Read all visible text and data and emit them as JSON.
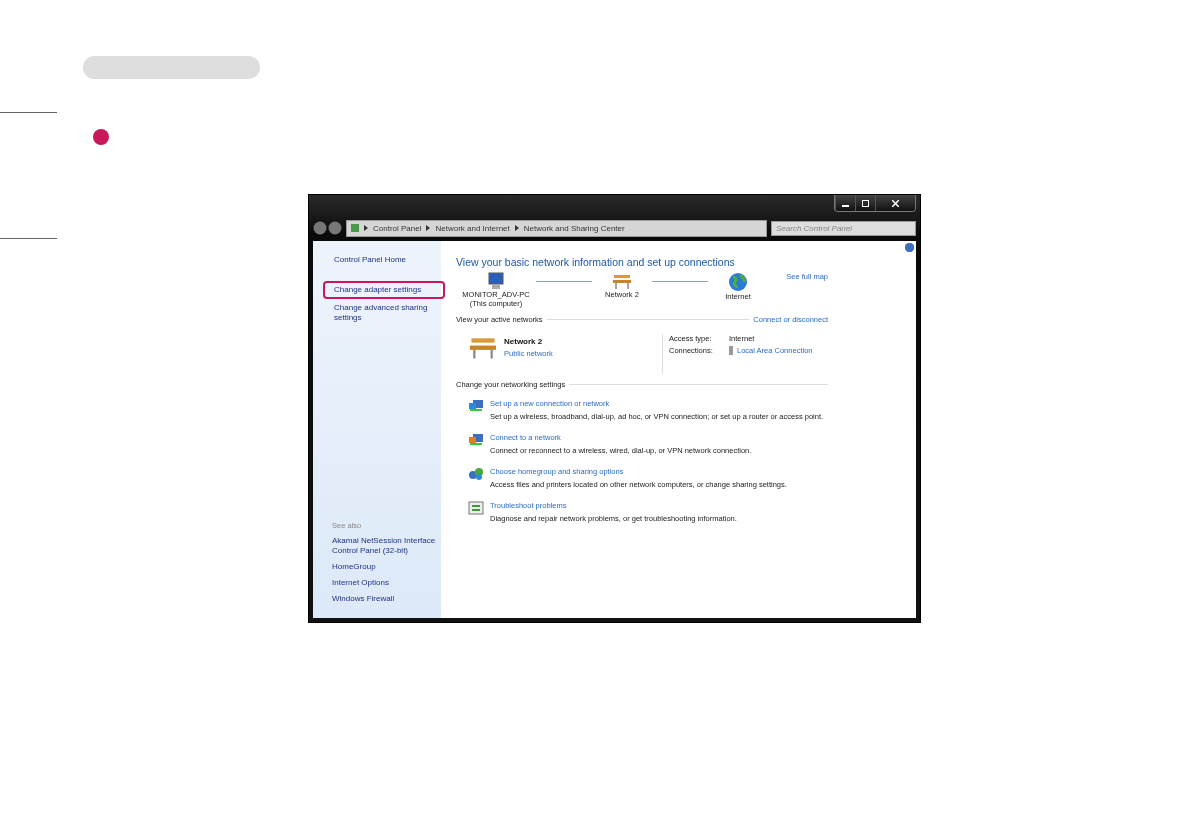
{
  "step_marker": {
    "color": "#c8185a"
  },
  "window": {
    "buttons": [
      {
        "kind": "minimize"
      },
      {
        "kind": "maximize"
      },
      {
        "kind": "close"
      }
    ],
    "breadcrumb": [
      "Control Panel",
      "Network and Internet",
      "Network and Sharing Center"
    ],
    "search": {
      "placeholder": "Search Control Panel"
    },
    "sidebar": {
      "items": [
        {
          "label": "Control Panel Home",
          "highlighted": false
        },
        {
          "label": "Change adapter settings",
          "highlighted": true
        },
        {
          "label": "Change advanced sharing settings",
          "highlighted": false
        }
      ],
      "see_also_title": "See also",
      "see_also": [
        "Akamai NetSession Interface Control Panel (32-bit)",
        "HomeGroup",
        "Internet Options",
        "Windows Firewall"
      ]
    },
    "main": {
      "title": "View your basic network information and set up connections",
      "map": [
        {
          "kind": "computer",
          "label": "MONITOR_ADV-PC",
          "sublabel": "(This computer)"
        },
        {
          "kind": "bench",
          "label": "Network  2"
        },
        {
          "kind": "globe",
          "label": "Internet"
        }
      ],
      "see_full_map": "See full map",
      "active_title": "View your active networks",
      "connect_link": "Connect or disconnect",
      "network": {
        "name": "Network  2",
        "type": "Public network",
        "access_label": "Access type:",
        "access_value": "Internet",
        "connections_label": "Connections:",
        "connection": "Local Area Connection"
      },
      "settings_title": "Change your networking settings",
      "tasks": [
        {
          "kind": "new",
          "title": "Set up a new connection or network",
          "description": "Set up a wireless, broadband, dial-up, ad hoc, or VPN connection; or set up a router or access point."
        },
        {
          "kind": "connect",
          "title": "Connect to a network",
          "description": "Connect or reconnect to a wireless, wired, dial-up, or VPN network connection."
        },
        {
          "kind": "homegroup",
          "title": "Choose homegroup and sharing options",
          "description": "Access files and printers located on other network computers, or change sharing settings."
        },
        {
          "kind": "troubleshoot",
          "title": "Troubleshoot problems",
          "description": "Diagnose and repair network problems, or get troubleshooting information."
        }
      ]
    }
  }
}
